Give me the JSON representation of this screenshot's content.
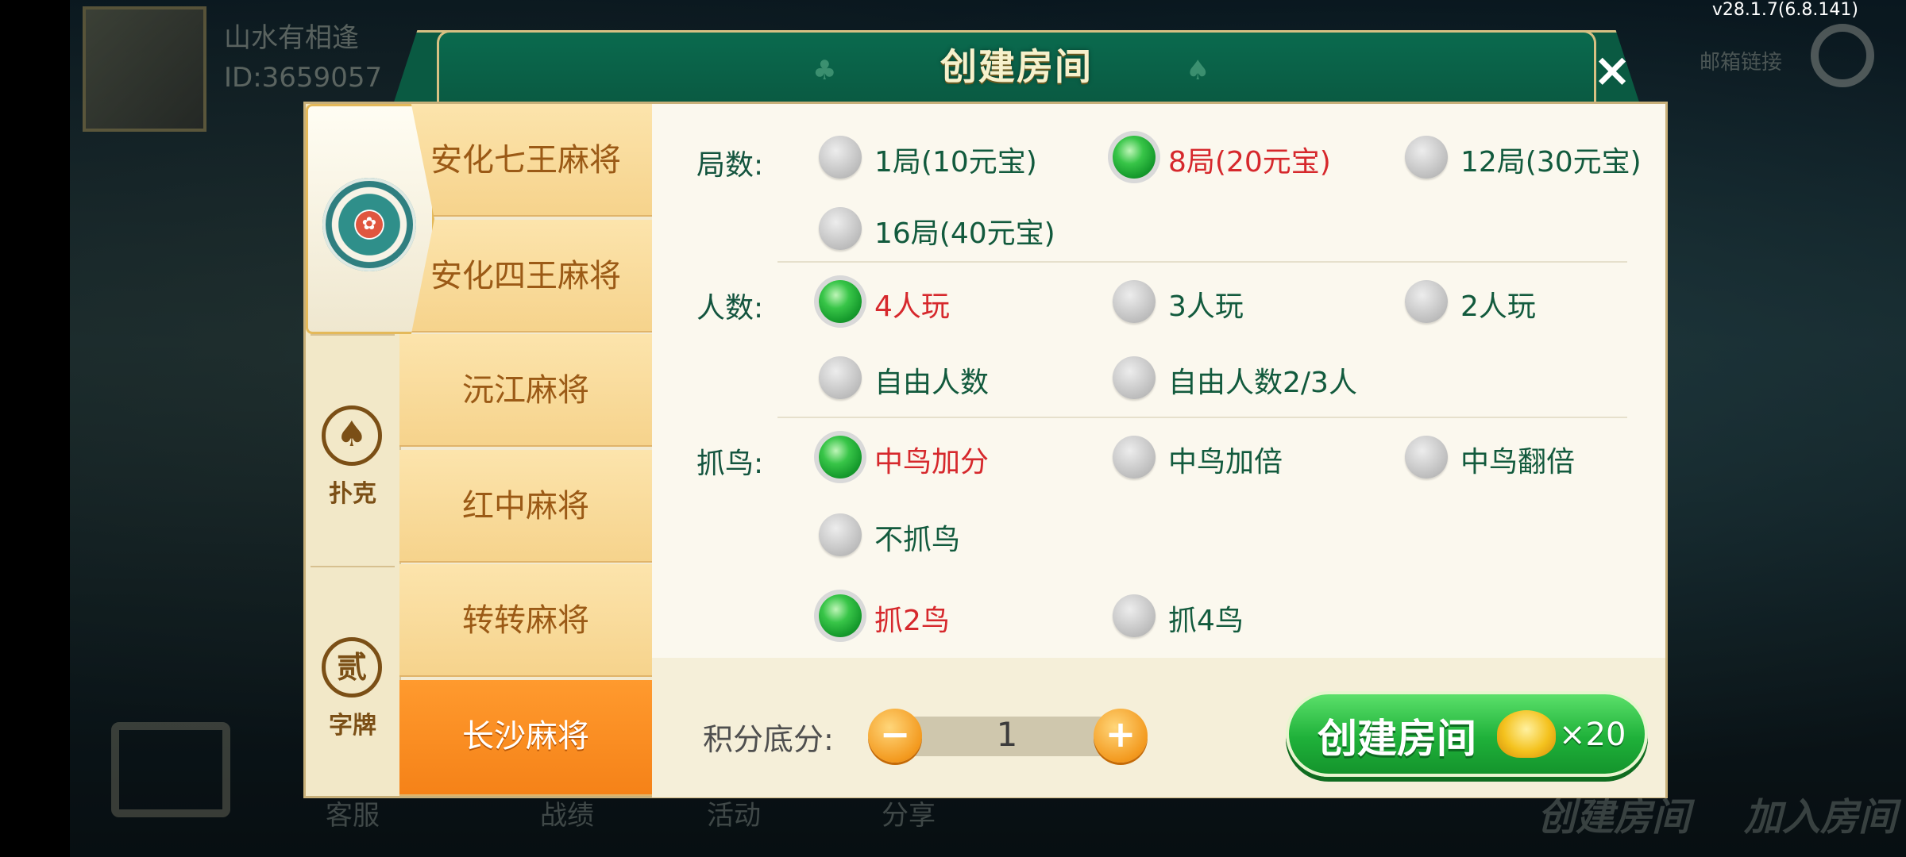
{
  "version": "v28.1.7(6.8.141)",
  "background": {
    "player_name": "山水有相逢",
    "player_id": "ID:3659057",
    "top_right_label": "邮箱链接",
    "bottom_tabs": [
      "客服",
      "战绩",
      "活动",
      "分享"
    ],
    "bottom_buttons": [
      "创建房间",
      "加入房间"
    ]
  },
  "dialog": {
    "title": "创建房间",
    "close_label": "×"
  },
  "categories": [
    {
      "label": "",
      "icon": "mahjong-emblem-icon",
      "active": true
    },
    {
      "label": "扑克",
      "icon": "spade-icon",
      "glyph": "♠"
    },
    {
      "label": "字牌",
      "icon": "zipai-icon",
      "glyph": "贰"
    }
  ],
  "games": [
    {
      "label": "安化七王麻将",
      "selected": false
    },
    {
      "label": "安化四王麻将",
      "selected": false
    },
    {
      "label": "沅江麻将",
      "selected": false
    },
    {
      "label": "红中麻将",
      "selected": false
    },
    {
      "label": "转转麻将",
      "selected": false
    },
    {
      "label": "长沙麻将",
      "selected": true
    }
  ],
  "options": {
    "rounds": {
      "label": "局数:",
      "choices": [
        {
          "text": "1局(10元宝)",
          "selected": false
        },
        {
          "text": "8局(20元宝)",
          "selected": true
        },
        {
          "text": "12局(30元宝)",
          "selected": false
        },
        {
          "text": "16局(40元宝)",
          "selected": false
        }
      ]
    },
    "players": {
      "label": "人数:",
      "choices": [
        {
          "text": "4人玩",
          "selected": true
        },
        {
          "text": "3人玩",
          "selected": false
        },
        {
          "text": "2人玩",
          "selected": false
        },
        {
          "text": "自由人数",
          "selected": false
        },
        {
          "text": "自由人数2/3人",
          "selected": false
        }
      ]
    },
    "birds": {
      "label": "抓鸟:",
      "choices": [
        {
          "text": "中鸟加分",
          "selected": true
        },
        {
          "text": "中鸟加倍",
          "selected": false
        },
        {
          "text": "中鸟翻倍",
          "selected": false
        },
        {
          "text": "不抓鸟",
          "selected": false
        }
      ],
      "count_choices": [
        {
          "text": "抓2鸟",
          "selected": true
        },
        {
          "text": "抓4鸟",
          "selected": false
        }
      ]
    }
  },
  "score": {
    "label": "积分底分:",
    "value": "1",
    "minus": "−",
    "plus": "+"
  },
  "create_button": {
    "label": "创建房间",
    "cost": "×20",
    "icon": "gold-ingot-icon"
  },
  "colors": {
    "selected_text": "#d6282c",
    "option_text": "#125a3d",
    "header_green": "#0a6a4e",
    "selected_tab_orange": "#f58218",
    "create_green": "#1fb13a"
  }
}
